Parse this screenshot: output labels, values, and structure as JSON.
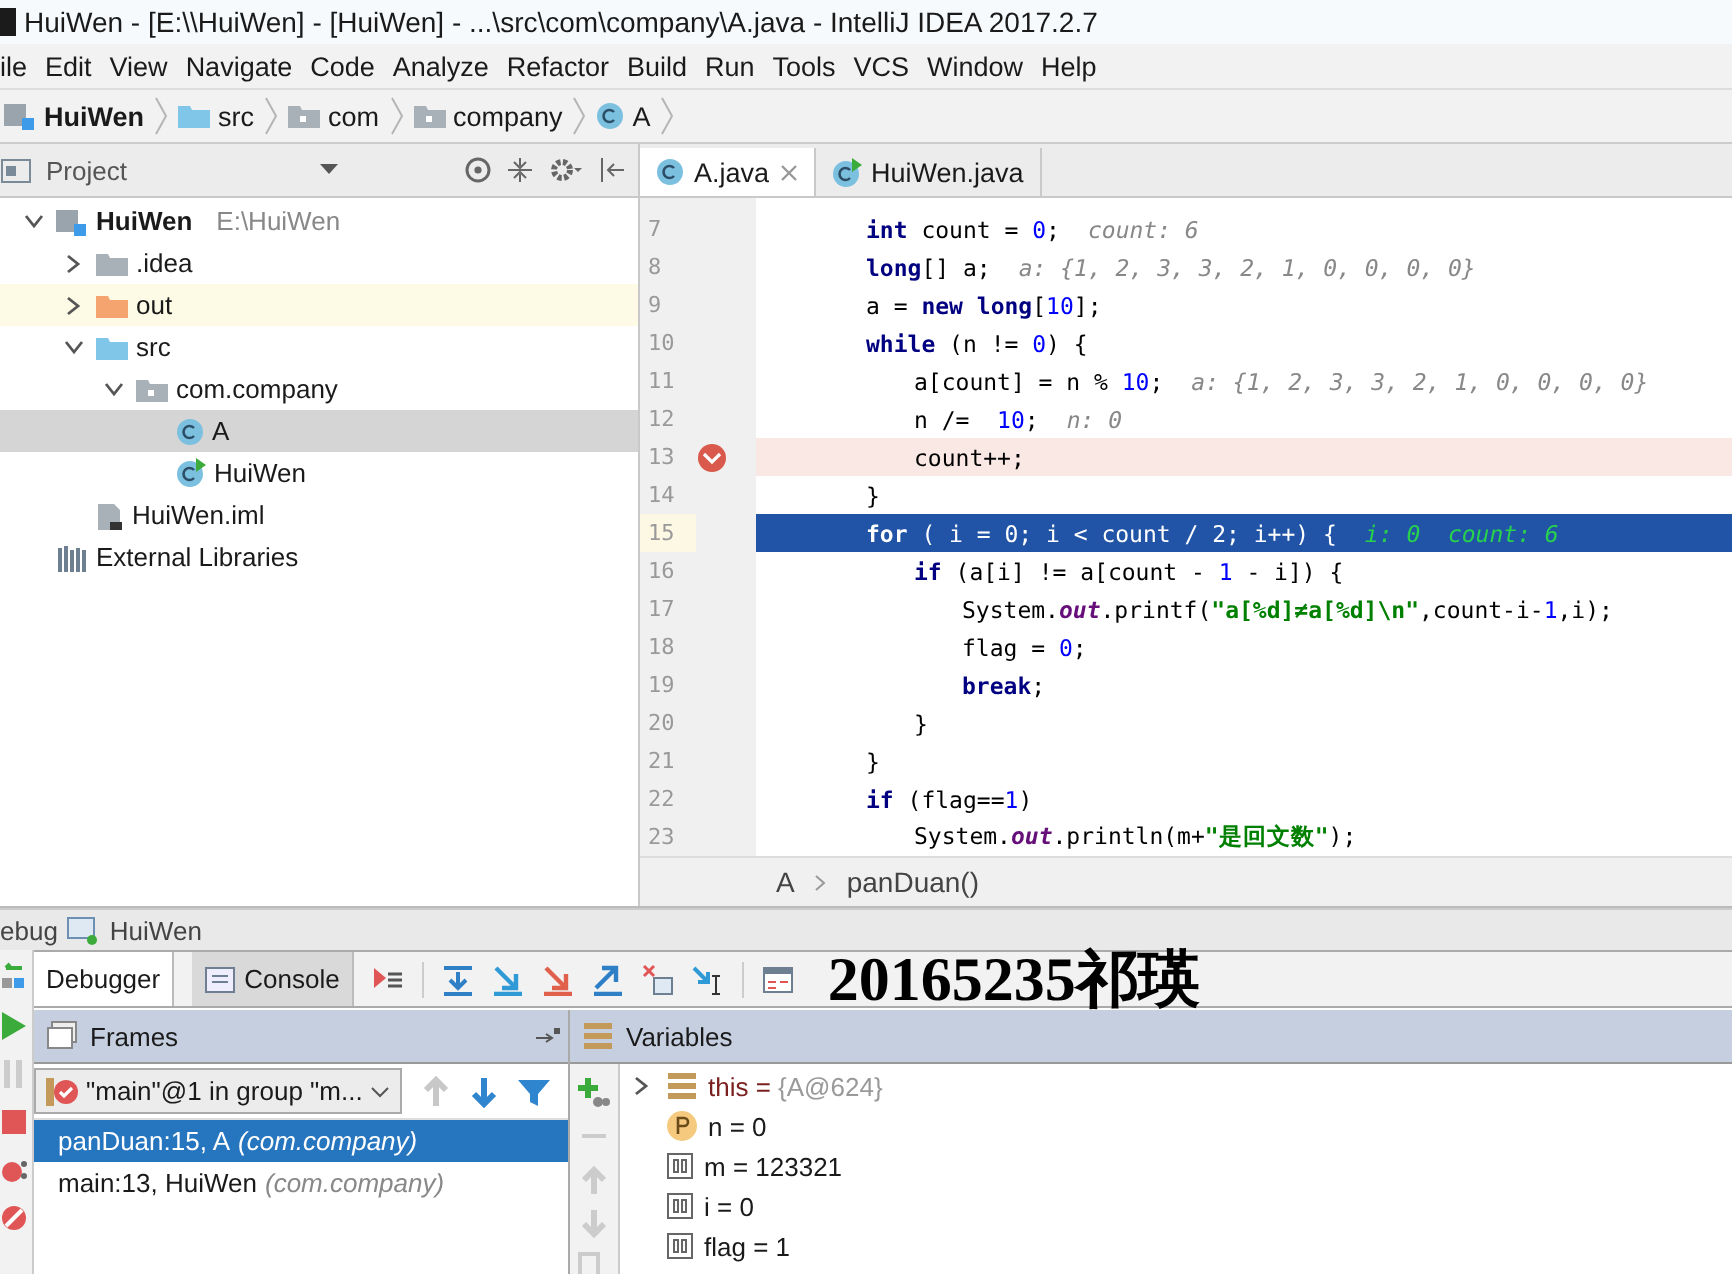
{
  "window": {
    "title": "HuiWen - [E:\\\\HuiWen] - [HuiWen] - ...\\src\\com\\company\\A.java - IntelliJ IDEA 2017.2.7"
  },
  "menu": [
    "ile",
    "Edit",
    "View",
    "Navigate",
    "Code",
    "Analyze",
    "Refactor",
    "Build",
    "Run",
    "Tools",
    "VCS",
    "Window",
    "Help"
  ],
  "nav_bar": [
    {
      "label": "HuiWen",
      "kind": "module"
    },
    {
      "label": "src",
      "kind": "source"
    },
    {
      "label": "com",
      "kind": "package"
    },
    {
      "label": "company",
      "kind": "package"
    },
    {
      "label": "A",
      "kind": "class"
    }
  ],
  "project": {
    "title": "Project",
    "tree": [
      {
        "label": "HuiWen",
        "path": "E:\\HuiWen",
        "kind": "module",
        "expanded": true,
        "selected": false,
        "children": [
          {
            "label": ".idea",
            "kind": "folder",
            "expanded": false,
            "selected": false
          },
          {
            "label": "out",
            "kind": "excluded",
            "expanded": false,
            "selected": false
          },
          {
            "label": "src",
            "kind": "source",
            "expanded": true,
            "selected": false,
            "children": [
              {
                "label": "com.company",
                "kind": "package",
                "expanded": true,
                "selected": false,
                "children": [
                  {
                    "label": "A",
                    "kind": "class",
                    "selected": true
                  },
                  {
                    "label": "HuiWen",
                    "kind": "main",
                    "selected": false
                  }
                ]
              }
            ]
          },
          {
            "label": "HuiWen.iml",
            "kind": "file",
            "selected": false
          }
        ]
      },
      {
        "label": "External Libraries",
        "kind": "library",
        "selected": false
      }
    ]
  },
  "editor_tabs": [
    {
      "label": "A.java",
      "kind": "class",
      "selected": true,
      "closable": true
    },
    {
      "label": "HuiWen.java",
      "kind": "main",
      "selected": false,
      "closable": false
    }
  ],
  "code": [
    {
      "number": "7",
      "breakpoint": false,
      "current": false,
      "tokens": [
        {
          "kind": "kw",
          "text": "int"
        },
        {
          "kind": "p",
          "text": " count = "
        },
        {
          "kind": "num",
          "text": "0"
        },
        {
          "kind": "p",
          "text": ";"
        }
      ],
      "hint": "count: 6"
    },
    {
      "number": "8",
      "breakpoint": false,
      "current": false,
      "tokens": [
        {
          "kind": "kw",
          "text": "long"
        },
        {
          "kind": "p",
          "text": "[] a;"
        }
      ],
      "hint": "a: {1, 2, 3, 3, 2, 1, 0, 0, 0, 0}"
    },
    {
      "number": "9",
      "breakpoint": false,
      "current": false,
      "tokens": [
        {
          "kind": "p",
          "text": "a = "
        },
        {
          "kind": "kw",
          "text": "new long"
        },
        {
          "kind": "p",
          "text": "["
        },
        {
          "kind": "num",
          "text": "10"
        },
        {
          "kind": "p",
          "text": "];"
        }
      ]
    },
    {
      "number": "10",
      "breakpoint": false,
      "current": false,
      "tokens": [
        {
          "kind": "kw",
          "text": "while"
        },
        {
          "kind": "p",
          "text": " (n != "
        },
        {
          "kind": "num",
          "text": "0"
        },
        {
          "kind": "p",
          "text": ") {"
        }
      ],
      "children": [
        {
          "number": "11",
          "breakpoint": false,
          "current": false,
          "tokens": [
            {
              "kind": "p",
              "text": "a[count] = n % "
            },
            {
              "kind": "num",
              "text": "10"
            },
            {
              "kind": "p",
              "text": ";"
            }
          ],
          "hint": "a: {1, 2, 3, 3, 2, 1, 0, 0, 0, 0}"
        },
        {
          "number": "12",
          "breakpoint": false,
          "current": false,
          "tokens": [
            {
              "kind": "p",
              "text": "n /=  "
            },
            {
              "kind": "num",
              "text": "10"
            },
            {
              "kind": "p",
              "text": ";"
            }
          ],
          "hint": "n: 0"
        },
        {
          "number": "13",
          "breakpoint": true,
          "current": false,
          "tokens": [
            {
              "kind": "p",
              "text": "count++;"
            }
          ]
        }
      ]
    },
    {
      "number": "14",
      "breakpoint": false,
      "current": false,
      "tokens": [
        {
          "kind": "p",
          "text": "}"
        }
      ]
    },
    {
      "number": "15",
      "breakpoint": false,
      "current": true,
      "tokens": [
        {
          "kind": "kw",
          "text": "for"
        },
        {
          "kind": "p",
          "text": " ( i = 0; i < count / 2; i++) {"
        }
      ],
      "hint": "i: 0  count: 6",
      "children": [
        {
          "number": "16",
          "breakpoint": false,
          "current": false,
          "tokens": [
            {
              "kind": "kw",
              "text": "if"
            },
            {
              "kind": "p",
              "text": " (a[i] != a[count - "
            },
            {
              "kind": "num",
              "text": "1"
            },
            {
              "kind": "p",
              "text": " - i]) {"
            }
          ],
          "children": [
            {
              "number": "17",
              "breakpoint": false,
              "current": false,
              "tokens": [
                {
                  "kind": "p",
                  "text": "System."
                },
                {
                  "kind": "field",
                  "text": "out"
                },
                {
                  "kind": "p",
                  "text": ".printf("
                },
                {
                  "kind": "str",
                  "text": "\"a[%d]≠a[%d]\\n\""
                },
                {
                  "kind": "p",
                  "text": ",count-i-"
                },
                {
                  "kind": "num",
                  "text": "1"
                },
                {
                  "kind": "p",
                  "text": ",i);"
                }
              ]
            },
            {
              "number": "18",
              "breakpoint": false,
              "current": false,
              "tokens": [
                {
                  "kind": "p",
                  "text": "flag = "
                },
                {
                  "kind": "num",
                  "text": "0"
                },
                {
                  "kind": "p",
                  "text": ";"
                }
              ]
            },
            {
              "number": "19",
              "breakpoint": false,
              "current": false,
              "tokens": [
                {
                  "kind": "kw",
                  "text": "break"
                },
                {
                  "kind": "p",
                  "text": ";"
                }
              ]
            }
          ]
        },
        {
          "number": "20",
          "breakpoint": false,
          "current": false,
          "tokens": [
            {
              "kind": "p",
              "text": "}"
            }
          ]
        }
      ]
    },
    {
      "number": "21",
      "breakpoint": false,
      "current": false,
      "tokens": [
        {
          "kind": "p",
          "text": "}"
        }
      ]
    },
    {
      "number": "22",
      "breakpoint": false,
      "current": false,
      "tokens": [
        {
          "kind": "kw",
          "text": "if"
        },
        {
          "kind": "p",
          "text": " (flag=="
        },
        {
          "kind": "num",
          "text": "1"
        },
        {
          "kind": "p",
          "text": ")"
        }
      ],
      "children": [
        {
          "number": "23",
          "breakpoint": false,
          "current": false,
          "tokens": [
            {
              "kind": "p",
              "text": "System."
            },
            {
              "kind": "field",
              "text": "out"
            },
            {
              "kind": "p",
              "text": ".println(m+"
            },
            {
              "kind": "str",
              "text": "\"是回文数\""
            },
            {
              "kind": "p",
              "text": ");"
            }
          ]
        }
      ]
    }
  ],
  "editor_breadcrumb": [
    "A",
    "panDuan()"
  ],
  "debug": {
    "title": "ebug",
    "config": "HuiWen",
    "tabs": [
      {
        "label": "Debugger",
        "selected": true
      },
      {
        "label": "Console",
        "selected": false
      }
    ],
    "annotation": "20165235祁瑛",
    "frames": {
      "title": "Frames",
      "thread": "\"main\"@1 in group \"m...",
      "items": [
        {
          "method": "panDuan:15, A",
          "package": "(com.company)",
          "selected": true
        },
        {
          "method": "main:13, HuiWen",
          "package": "(com.company)",
          "selected": false
        }
      ]
    },
    "variables": {
      "title": "Variables",
      "items": [
        {
          "kind": "object",
          "label": "this =",
          "value": "{A@624}",
          "expanded": false
        },
        {
          "kind": "param",
          "label": "n =",
          "value": "0"
        },
        {
          "kind": "local",
          "label": "m =",
          "value": "123321"
        },
        {
          "kind": "local",
          "label": "i =",
          "value": "0"
        },
        {
          "kind": "local",
          "label": "flag =",
          "value": "1"
        }
      ]
    }
  }
}
